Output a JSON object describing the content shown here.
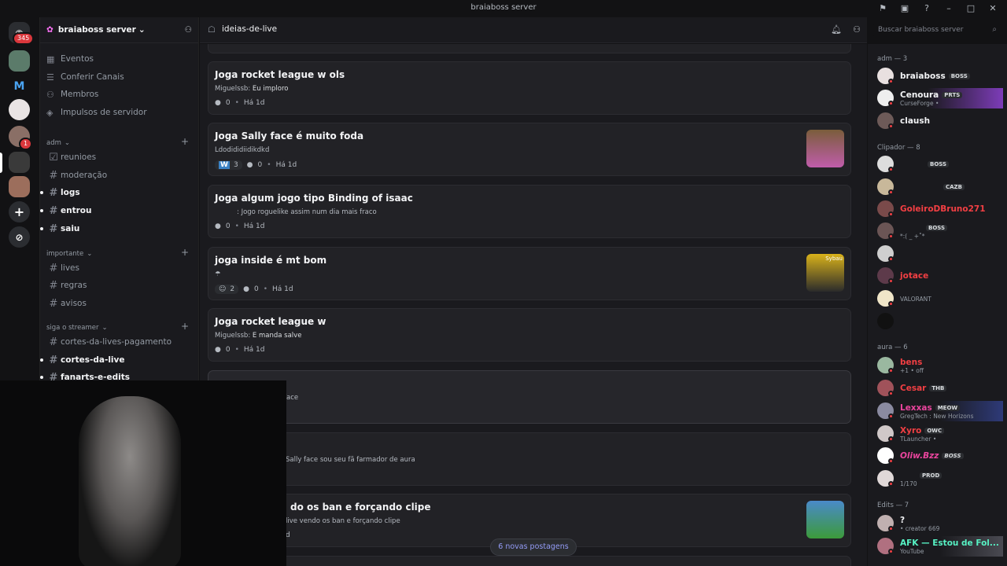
{
  "window": {
    "title": "braiaboss server"
  },
  "rail": {
    "home_badge": "345",
    "server_badge": "1"
  },
  "server": {
    "name": "braiaboss server"
  },
  "nav": [
    "Eventos",
    "Conferir Canais",
    "Membros",
    "Impulsos de servidor"
  ],
  "categories": [
    {
      "name": "adm",
      "channels": [
        {
          "n": "reunioes",
          "u": false
        },
        {
          "n": "moderação",
          "u": false
        },
        {
          "n": "logs",
          "u": true
        },
        {
          "n": "entrou",
          "u": true
        },
        {
          "n": "saiu",
          "u": true
        }
      ]
    },
    {
      "name": "importante",
      "channels": [
        {
          "n": "lives",
          "u": false
        },
        {
          "n": "regras",
          "u": false
        },
        {
          "n": "avisos",
          "u": false
        }
      ]
    },
    {
      "name": "siga o streamer",
      "channels": [
        {
          "n": "cortes-da-lives-pagamento",
          "u": false
        },
        {
          "n": "cortes-da-live",
          "u": true
        },
        {
          "n": "fanarts-e-edits",
          "u": true
        }
      ]
    }
  ],
  "channel": {
    "name": "ideias-de-live"
  },
  "search": {
    "placeholder": "Buscar braiaboss server"
  },
  "posts": [
    {
      "title": "Joga rocket league w ols",
      "author": "Miguelssb",
      "text": "Eu imploro",
      "comments": "0",
      "time": "Há 1d"
    },
    {
      "title": "Joga Sally face é muito foda",
      "author": "",
      "text": "Ldodididiidikdkd",
      "react": "3",
      "comments": "0",
      "time": "Há 1d"
    },
    {
      "title": "Joga algum jogo tipo Binding of isaac",
      "author": "",
      "text": ": Jogo roguelike assim num dia mais fraco",
      "comments": "0",
      "time": "Há 1d"
    },
    {
      "title": "joga inside é mt bom",
      "author": "",
      "text": "",
      "react": "2",
      "comments": "0",
      "time": "Há 1d"
    },
    {
      "title": "Joga rocket league w",
      "author": "Miguelssb",
      "text": "E manda salve",
      "comments": "0",
      "time": "Há 1d"
    },
    {
      "title": "",
      "author": "",
      "text": "face",
      "comments": "",
      "time": ""
    },
    {
      "title": "",
      "author": "",
      "text": "Sally face sou seu fã farmador de aura",
      "comments": "",
      "time": ""
    },
    {
      "title": "do os ban e forçando clipe",
      "author": "",
      "text": "live vendo os ban e forçando clipe",
      "comments": "",
      "time": "d"
    }
  ],
  "thumb_label": "Sybau",
  "new_posts": "6 novas postagens",
  "member_groups": [
    {
      "label": "adm — 3"
    },
    {
      "label": "Clipador — 8"
    },
    {
      "label": "aura — 6"
    },
    {
      "label": "Edits — 7"
    }
  ],
  "members": [
    {
      "name": "braiaboss",
      "tag": "BOSS",
      "sub": "",
      "color": "#f2f3f5"
    },
    {
      "name": "Cenoura",
      "tag": "PRTS",
      "sub": "CurseForge •",
      "color": "#f2f3f5"
    },
    {
      "name": "claush",
      "tag": "",
      "sub": "",
      "color": "#f2f3f5"
    },
    {
      "name": "",
      "tag": "BOSS",
      "sub": "",
      "color": "#f2f3f5"
    },
    {
      "name": "",
      "tag": "CAZB",
      "sub": "",
      "color": "#f2f3f5"
    },
    {
      "name": "GoleiroDBruno271",
      "tag": "",
      "sub": "",
      "color": "#f23f43"
    },
    {
      "name": "",
      "tag": "BOSS",
      "sub": "*:( _ +˚*",
      "color": "#f2f3f5"
    },
    {
      "name": "",
      "tag": "",
      "sub": "",
      "color": "#f2f3f5"
    },
    {
      "name": "jotace",
      "tag": "",
      "sub": "",
      "color": "#f23f43"
    },
    {
      "name": "",
      "tag": "",
      "sub": "VALORANT",
      "color": "#f2f3f5"
    },
    {
      "name": "",
      "tag": "",
      "sub": "",
      "color": "#f2f3f5"
    },
    {
      "name": "bens",
      "tag": "",
      "sub": "+1 • off",
      "color": "#f23f43"
    },
    {
      "name": "Cesar",
      "tag": "THB",
      "sub": "",
      "color": "#f23f43"
    },
    {
      "name": "Lexxas",
      "tag": "MEOW",
      "sub": "GregTech : New Horizons",
      "color": "#eb459e"
    },
    {
      "name": "Xyro",
      "tag": "OWC",
      "sub": "TLauncher •",
      "color": "#f23f43"
    },
    {
      "name": "Oliw.Bzz",
      "tag": "BOSS",
      "sub": "",
      "color": "#eb459e"
    },
    {
      "name": "",
      "tag": "PROD",
      "sub": "1/170",
      "color": "#f2f3f5"
    },
    {
      "name": "?",
      "tag": "",
      "sub": "• creator 669",
      "color": "#f2f3f5"
    },
    {
      "name": "AFK — Estou de Fol...",
      "tag": "",
      "sub": "YouTube",
      "color": "#57f2c4"
    }
  ]
}
